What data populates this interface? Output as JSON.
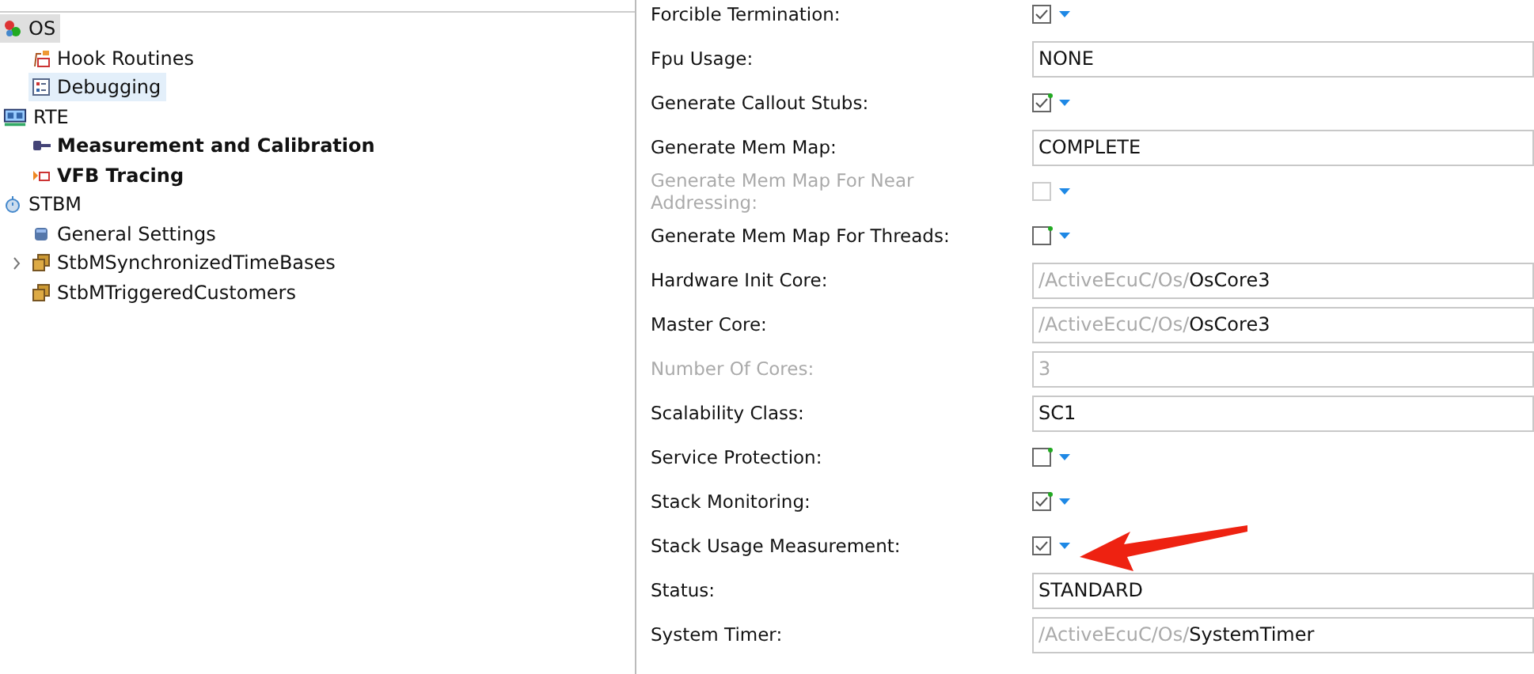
{
  "tree": [
    {
      "label": "OS",
      "kind": "os",
      "bold": false,
      "selected": true,
      "children": [
        {
          "label": "Hook Routines",
          "kind": "hook",
          "bold": false,
          "selected": false,
          "collapsed": false
        },
        {
          "label": "Debugging",
          "kind": "debug",
          "bold": false,
          "selected": true,
          "collapsed": false
        }
      ]
    },
    {
      "label": "RTE",
      "kind": "rte",
      "bold": false,
      "selected": false,
      "children": [
        {
          "label": "Measurement and Calibration",
          "kind": "measure",
          "bold": true,
          "selected": false,
          "collapsed": false
        },
        {
          "label": "VFB Tracing",
          "kind": "vfb",
          "bold": true,
          "selected": false,
          "collapsed": false
        }
      ]
    },
    {
      "label": "STBM",
      "kind": "stbm",
      "bold": false,
      "selected": false,
      "children": [
        {
          "label": "General Settings",
          "kind": "settings",
          "bold": false,
          "selected": false,
          "collapsed": false
        },
        {
          "label": "StbMSynchronizedTimeBases",
          "kind": "container",
          "bold": false,
          "selected": false,
          "collapsed": true
        },
        {
          "label": "StbMTriggeredCustomers",
          "kind": "container",
          "bold": false,
          "selected": false,
          "collapsed": false
        }
      ]
    }
  ],
  "properties": [
    {
      "label": "Forcible Termination:",
      "kind": "checkbox",
      "checked": true,
      "disabled": false
    },
    {
      "label": "Fpu Usage:",
      "kind": "text",
      "value": "NONE",
      "disabled": false
    },
    {
      "label": "Generate Callout Stubs:",
      "kind": "checkbox",
      "checked": true,
      "modified": true,
      "disabled": false
    },
    {
      "label": "Generate Mem Map:",
      "kind": "text",
      "value": "COMPLETE",
      "disabled": false
    },
    {
      "label": "Generate Mem Map For Near Addressing:",
      "kind": "checkbox",
      "checked": false,
      "modified": false,
      "disabled": true
    },
    {
      "label": "Generate Mem Map For Threads:",
      "kind": "checkbox",
      "checked": false,
      "modified": true,
      "disabled": false
    },
    {
      "label": "Hardware Init Core:",
      "kind": "reference",
      "prefix": "/ActiveEcuC/Os/",
      "target": "OsCore3"
    },
    {
      "label": "Master Core:",
      "kind": "reference",
      "prefix": "/ActiveEcuC/Os/",
      "target": "OsCore3"
    },
    {
      "label": "Number Of Cores:",
      "kind": "text",
      "value": "3",
      "disabled": true
    },
    {
      "label": "Scalability Class:",
      "kind": "text",
      "value": "SC1",
      "disabled": false
    },
    {
      "label": "Service Protection:",
      "kind": "checkbox",
      "checked": false,
      "modified": true,
      "disabled": false
    },
    {
      "label": "Stack Monitoring:",
      "kind": "checkbox",
      "checked": true,
      "modified": true,
      "disabled": false
    },
    {
      "label": "Stack Usage Measurement:",
      "kind": "checkbox",
      "checked": true,
      "modified": false,
      "disabled": false
    },
    {
      "label": "Status:",
      "kind": "text",
      "value": "STANDARD",
      "disabled": false
    },
    {
      "label": "System Timer:",
      "kind": "reference",
      "prefix": "/ActiveEcuC/Os/",
      "target": "SystemTimer"
    }
  ]
}
